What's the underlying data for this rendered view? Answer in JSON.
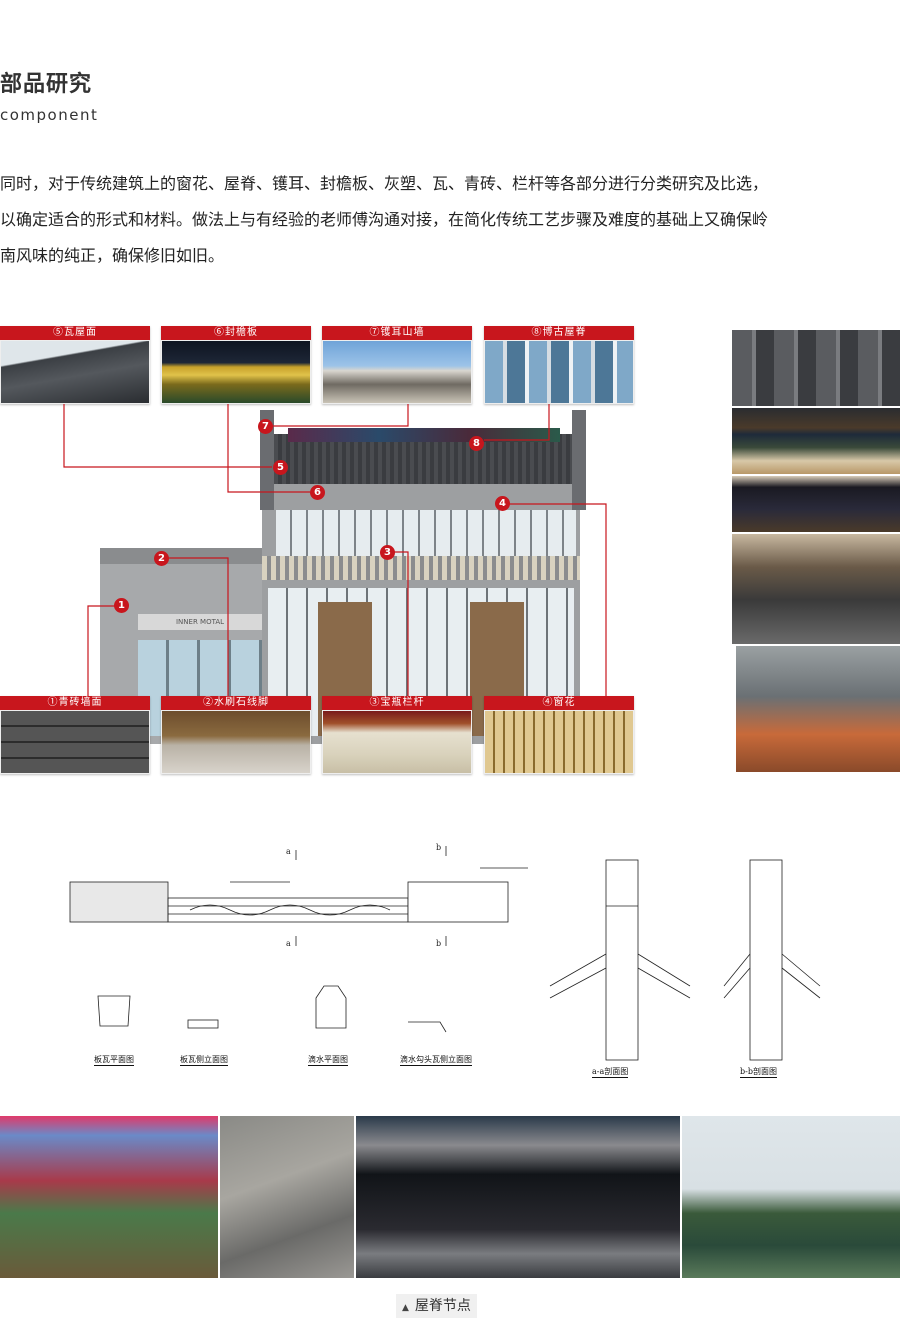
{
  "heading": {
    "title": "部品研究",
    "subtitle": "component"
  },
  "intro": {
    "lines": [
      "同时，对于传统建筑上的窗花、屋脊、镬耳、封檐板、灰塑、瓦、青砖、栏杆等各部分进行分类研究及比选，",
      "以确定适合的形式和材料。做法上与有经验的老师傅沟通对接，在简化传统工艺步骤及难度的基础上又确保岭",
      "南风味的纯正，确保修旧如旧。"
    ]
  },
  "diagram": {
    "top_cards": [
      {
        "label": "⑤瓦屋面",
        "image": "tile-roof-photo"
      },
      {
        "label": "⑥封檐板",
        "image": "eave-board-photo"
      },
      {
        "label": "⑦镬耳山墙",
        "image": "wok-ear-gable-photo"
      },
      {
        "label": "⑧博古屋脊",
        "image": "bogu-ridge-photo"
      }
    ],
    "bottom_cards": [
      {
        "label": "①青砖墙面",
        "image": "blue-brick-wall-photo"
      },
      {
        "label": "②水刷石线脚",
        "image": "granite-moulding-photo"
      },
      {
        "label": "③宝瓶栏杆",
        "image": "vase-balustrade-photo"
      },
      {
        "label": "④窗花",
        "image": "window-lattice-photo"
      }
    ],
    "pins": [
      "1",
      "2",
      "3",
      "4",
      "5",
      "6",
      "7",
      "8"
    ],
    "building_sign": "INNER MOTAL"
  },
  "drawings": {
    "labels": [
      "板瓦平面图",
      "板瓦侧立面图",
      "滴水平面图",
      "滴水勾头瓦侧立面图",
      "a-a剖面图",
      "b-b剖面图"
    ],
    "section_marks": [
      "a",
      "a",
      "b",
      "b"
    ]
  },
  "caption": {
    "text": "屋脊节点",
    "icon": "triangle-up-icon"
  },
  "colors": {
    "accent": "#c8161d",
    "text": "#222222"
  }
}
